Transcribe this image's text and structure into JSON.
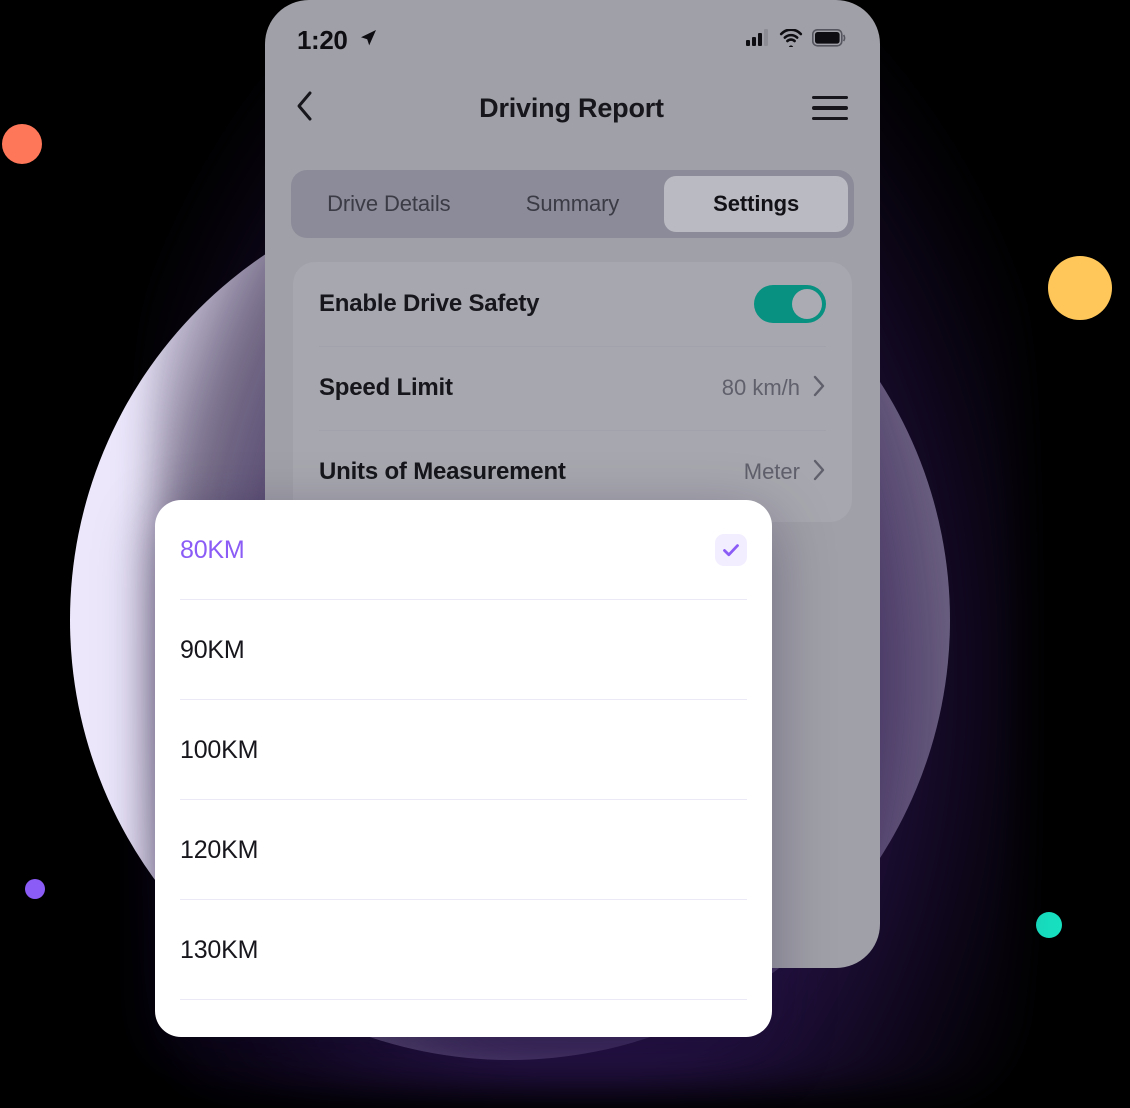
{
  "statusbar": {
    "time": "1:20",
    "location_icon": "location-arrow-icon",
    "signal_icon": "cellular-signal-icon",
    "wifi_icon": "wifi-icon",
    "battery_icon": "battery-full-icon"
  },
  "navbar": {
    "back_icon": "chevron-left-icon",
    "title": "Driving Report",
    "menu_icon": "hamburger-menu-icon"
  },
  "tabs": [
    {
      "label": "Drive Details",
      "active": false
    },
    {
      "label": "Summary",
      "active": false
    },
    {
      "label": "Settings",
      "active": true
    }
  ],
  "settings": {
    "rows": [
      {
        "label": "Enable Drive Safety",
        "control": "toggle",
        "value": "on"
      },
      {
        "label": "Speed Limit",
        "control": "disclosure",
        "value": "80 km/h",
        "chevron": "chevron-right-icon"
      },
      {
        "label": "Units of Measurement",
        "control": "disclosure",
        "value": "Meter",
        "chevron": "chevron-right-icon"
      }
    ]
  },
  "sheet": {
    "options": [
      {
        "label": "80KM",
        "selected": true,
        "check_icon": "check-icon"
      },
      {
        "label": "90KM",
        "selected": false
      },
      {
        "label": "100KM",
        "selected": false
      },
      {
        "label": "120KM",
        "selected": false
      },
      {
        "label": "130KM",
        "selected": false
      }
    ]
  },
  "colors": {
    "accent_purple": "#8b5cf6",
    "toggle_on": "#089180",
    "dot_orange": "#ff7759",
    "dot_yellow": "#ffc759",
    "dot_purple": "#8b5cf6",
    "dot_teal": "#17e0c0",
    "backdrop_circle": "#ece7fb"
  }
}
